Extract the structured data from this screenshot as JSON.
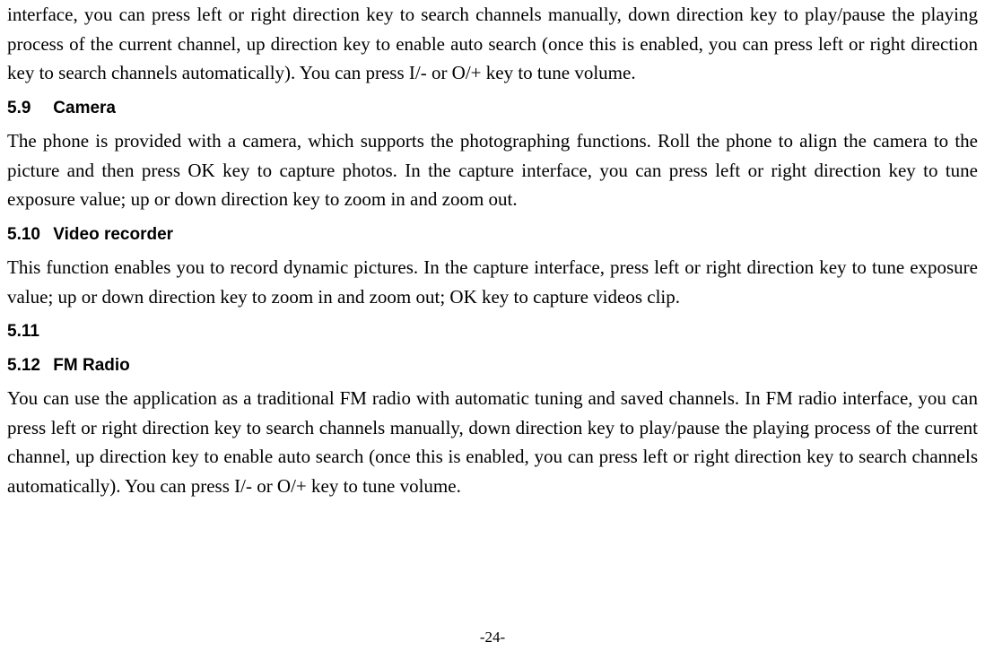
{
  "paragraphs": {
    "intro": "interface, you can press left or right direction key to search channels manually, down direction key to play/pause the playing process of the current channel, up direction key to enable auto search (once this is enabled, you can press left or right direction key to search channels automatically). You can press I/- or O/+ key to tune volume.",
    "camera": "The phone is provided with a camera, which supports the photographing functions. Roll the phone to align the camera to the picture and then press OK key to capture photos. In the capture interface, you can press left or right direction key to tune exposure value; up or down direction key to zoom in and zoom out.",
    "video": "This function enables you to record dynamic pictures. In the capture interface, press left or right direction key to tune exposure value; up or down direction key to zoom in and zoom out; OK key to capture videos clip.",
    "fm": "You can use the application as a traditional FM radio with automatic tuning and saved channels. In FM radio interface, you can press left or right direction key to search channels manually, down direction key to play/pause the playing process of the current channel, up direction key to enable auto search (once this is enabled, you can press left or right direction key to search channels automatically). You can press I/- or O/+ key to tune volume."
  },
  "headings": {
    "h59_num": "5.9",
    "h59_title": "Camera",
    "h510_num": "5.10",
    "h510_title": "Video recorder",
    "h511_num": "5.11",
    "h511_title": "",
    "h512_num": "5.12",
    "h512_title": "FM Radio"
  },
  "page_number": "-24-"
}
